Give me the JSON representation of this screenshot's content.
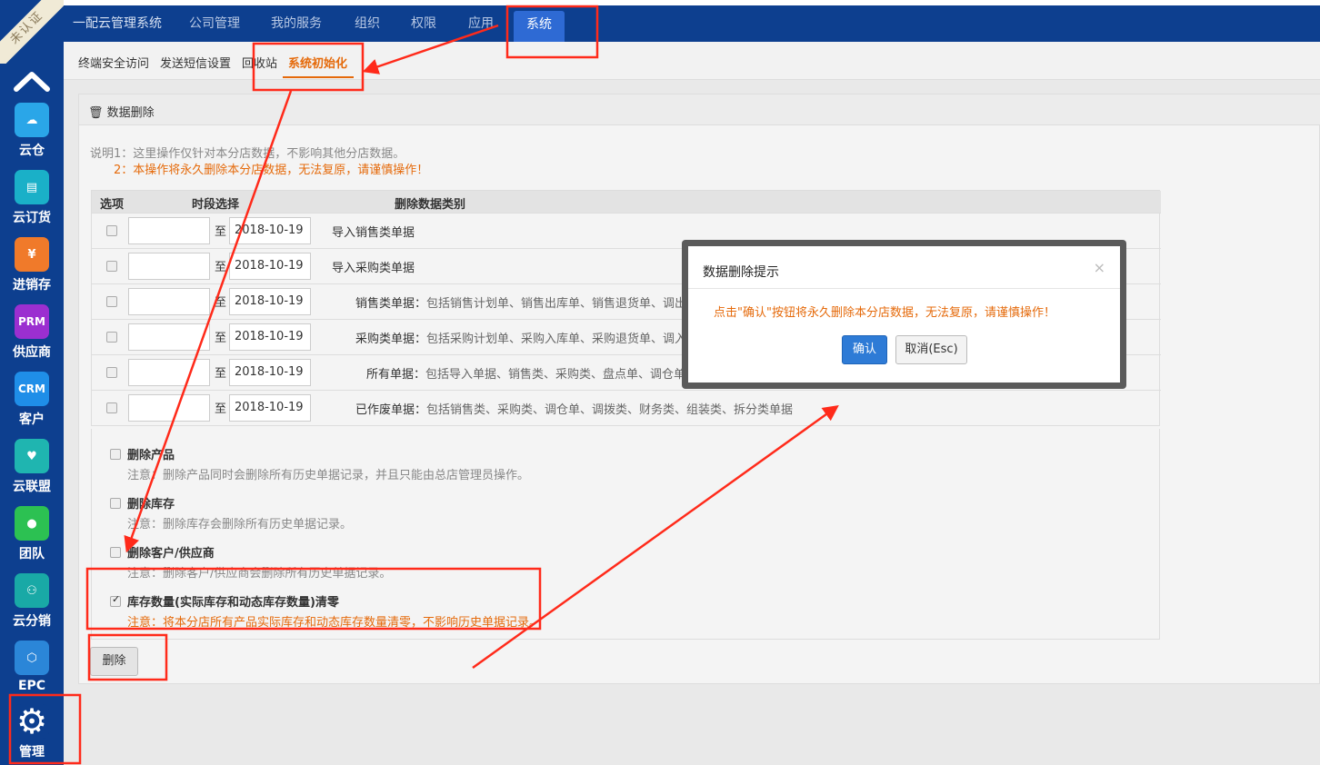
{
  "colors": {
    "nav": "#0d3f8f",
    "accent": "#e56a0b",
    "primary": "#2e7bd6",
    "annotation": "#ff2a1a"
  },
  "ribbon": "未认证",
  "sidebar": {
    "items": [
      {
        "label": "云仓",
        "icon": "cloud-icon",
        "glyph": "☁",
        "color": "#2aa6e8"
      },
      {
        "label": "云订货",
        "icon": "chat-icon",
        "glyph": "▤",
        "color": "#1ab0c8"
      },
      {
        "label": "进销存",
        "icon": "yen-icon",
        "glyph": "¥",
        "color": "#f07a2a"
      },
      {
        "label": "供应商",
        "icon": "prm-icon",
        "glyph": "PRM",
        "color": "#9b2fd0"
      },
      {
        "label": "客户",
        "icon": "crm-icon",
        "glyph": "CRM",
        "color": "#1f8ee8"
      },
      {
        "label": "云联盟",
        "icon": "heart-handshake-icon",
        "glyph": "♥",
        "color": "#1fb5b0"
      },
      {
        "label": "团队",
        "icon": "team-icon",
        "glyph": "●",
        "color": "#2cc152"
      },
      {
        "label": "云分销",
        "icon": "network-icon",
        "glyph": "⚇",
        "color": "#19a9a6"
      },
      {
        "label": "EPC",
        "icon": "hexagon-icon",
        "glyph": "⬡",
        "color": "#2b86d8"
      },
      {
        "label": "管理",
        "icon": "gear-icon",
        "glyph": "⚙",
        "color": "#0d3f8f"
      }
    ]
  },
  "topnav": [
    "一配云管理系统",
    "公司管理",
    "我的服务",
    "组织",
    "权限",
    "应用",
    "系统"
  ],
  "subnav": [
    "终端安全访问",
    "发送短信设置",
    "回收站",
    "系统初始化"
  ],
  "panel": {
    "title": "数据删除",
    "note1": "说明1：这里操作仅针对本分店数据，不影响其他分店数据。",
    "note2": "2：本操作将永久删除本分店数据，无法复原，请谨慎操作！"
  },
  "table": {
    "headers": [
      "选项",
      "时段选择",
      "删除数据类别"
    ],
    "to_label": "至",
    "rows": [
      {
        "end": "2018-10-19",
        "name": "导入销售类单据",
        "desc": ""
      },
      {
        "end": "2018-10-19",
        "name": "导入采购类单据",
        "desc": ""
      },
      {
        "end": "2018-10-19",
        "name": "销售类单据：",
        "desc": "包括销售计划单、销售出库单、销售退货单、调出单"
      },
      {
        "end": "2018-10-19",
        "name": "采购类单据：",
        "desc": "包括采购计划单、采购入库单、采购退货单、调入单"
      },
      {
        "end": "2018-10-19",
        "name": "所有单据：",
        "desc": "包括导入单据、销售类、采购类、盘点单、调仓单"
      },
      {
        "end": "2018-10-19",
        "name": "已作废单据：",
        "desc": "包括销售类、采购类、调仓单、调拨类、财务类、组装类、拆分类单据"
      }
    ]
  },
  "options": [
    {
      "title": "删除产品",
      "note": "注意：删除产品同时会删除所有历史单据记录，并且只能由总店管理员操作。",
      "checked": false
    },
    {
      "title": "删除库存",
      "note": "注意：删除库存会删除所有历史单据记录。",
      "checked": false
    },
    {
      "title": "删除客户/供应商",
      "note": "注意：删除客户/供应商会删除所有历史单据记录。",
      "checked": false
    },
    {
      "title": "库存数量(实际库存和动态库存数量)清零",
      "note": "注意：将本分店所有产品实际库存和动态库存数量清零，不影响历史单据记录。",
      "checked": true
    }
  ],
  "delete_button": "删除",
  "modal": {
    "title": "数据删除提示",
    "close": "×",
    "message": "点击\"确认\"按钮将永久删除本分店数据，无法复原，请谨慎操作！",
    "confirm": "确认",
    "cancel": "取消(Esc)"
  }
}
